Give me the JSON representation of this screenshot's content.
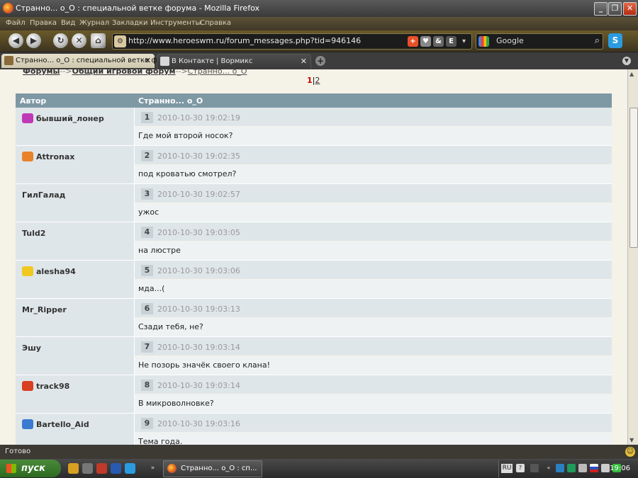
{
  "window": {
    "title": "Странно... о_О : специальной ветке форума - Mozilla Firefox",
    "buttons": [
      "_",
      "❐",
      "✕"
    ]
  },
  "menu": [
    "Файл",
    "Правка",
    "Вид",
    "Журнал",
    "Закладки",
    "Инструменты",
    "Справка"
  ],
  "nav": {
    "url": "http://www.heroeswm.ru/forum_messages.php?tid=946146",
    "search_placeholder": "Google"
  },
  "tabs": [
    {
      "label": "Странно... о_О : специальной ветке фор...",
      "active": true
    },
    {
      "label": "В Контакте | Вормикс",
      "active": false
    }
  ],
  "breadcrumb": {
    "forums": "Форумы",
    "sep1": "-->",
    "section": "Общий игровой форум",
    "sep2": "-->",
    "thread": "Странно... о_О"
  },
  "pager": {
    "current": "1",
    "sep": "|",
    "next": "2"
  },
  "table": {
    "col_author": "Автор",
    "col_thread": "Странно... о_О",
    "posts": [
      {
        "author": "бывший_лонер",
        "icon": "clan-icon-pink",
        "icon_color": "#c03ab8",
        "no": "1",
        "date": "2010-10-30 19:02:19",
        "text": "Где мой второй носок?"
      },
      {
        "author": "Attronax",
        "icon": "clan-icon-orange",
        "icon_color": "#e8822a",
        "no": "2",
        "date": "2010-10-30 19:02:35",
        "text": "под кроватью смотрел?"
      },
      {
        "author": "ГилГалад",
        "icon": "",
        "no": "3",
        "date": "2010-10-30 19:02:57",
        "text": "ужос"
      },
      {
        "author": "Tuld2",
        "icon": "",
        "no": "4",
        "date": "2010-10-30 19:03:05",
        "text": "на люстре"
      },
      {
        "author": "alesha94",
        "icon": "clan-icon-yellow",
        "icon_color": "#f0c820",
        "no": "5",
        "date": "2010-10-30 19:03:06",
        "text": "мда...("
      },
      {
        "author": "Mr_Ripper",
        "icon": "",
        "no": "6",
        "date": "2010-10-30 19:03:13",
        "text": "Сзади тебя, не?"
      },
      {
        "author": "Эшу",
        "icon": "",
        "no": "7",
        "date": "2010-10-30 19:03:14",
        "text": "Не позорь значёк своего клана!"
      },
      {
        "author": "track98",
        "icon": "clan-icon-red",
        "icon_color": "#d84020",
        "no": "8",
        "date": "2010-10-30 19:03:14",
        "text": "В микроволновке?"
      },
      {
        "author": "Bartello_Aid",
        "icon": "clan-icon-blue",
        "icon_color": "#3a7ad0",
        "no": "9",
        "date": "2010-10-30 19:03:16",
        "text": "Тема года."
      }
    ]
  },
  "status": "Готово",
  "taskbar": {
    "start": "пуск",
    "task_label": "Странно... о_О : сп...",
    "lang": "RU",
    "clock": "19:06"
  },
  "colors": {
    "table_header": "#7e98a4",
    "row_bg": "#dfe6e9",
    "message_bg": "#eef2f3",
    "pager_current": "#cc0000"
  }
}
